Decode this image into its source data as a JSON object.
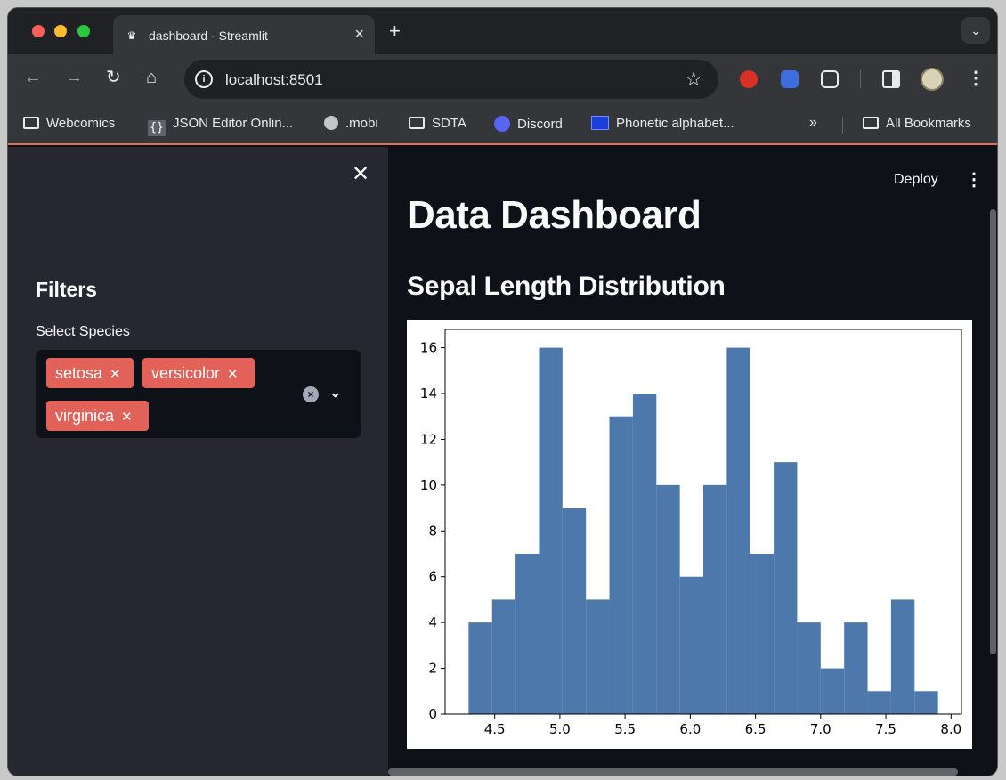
{
  "browser": {
    "tab_title": "dashboard · Streamlit",
    "tab_icon": "streamlit-crown-icon",
    "url": "localhost:8501",
    "bookmarks": [
      {
        "label": "Webcomics",
        "icon": "folder-icon"
      },
      {
        "label": "JSON Editor Onlin...",
        "icon": "braces-icon"
      },
      {
        "label": ".mobi",
        "icon": "globe-icon"
      },
      {
        "label": "SDTA",
        "icon": "folder-icon"
      },
      {
        "label": "Discord",
        "icon": "discord-icon"
      },
      {
        "label": "Phonetic alphabet...",
        "icon": "phonetic-icon"
      }
    ],
    "bookmarks_more": "»",
    "all_bookmarks": "All Bookmarks"
  },
  "sidebar": {
    "title": "Filters",
    "select_label": "Select Species",
    "chips": [
      "setosa",
      "versicolor",
      "virginica"
    ]
  },
  "main": {
    "deploy_label": "Deploy",
    "title": "Data Dashboard",
    "subtitle": "Sepal Length Distribution"
  },
  "colors": {
    "bar": "#4c78ab",
    "chip": "#e2625a",
    "sidebar_bg": "#262730",
    "main_bg": "#0e1117"
  },
  "chart_data": {
    "type": "bar",
    "title": "",
    "xlabel": "",
    "ylabel": "",
    "bin_edges": [
      4.3,
      4.48,
      4.66,
      4.84,
      5.02,
      5.2,
      5.38,
      5.56,
      5.74,
      5.92,
      6.1,
      6.28,
      6.46,
      6.64,
      6.82,
      7.0,
      7.18,
      7.36,
      7.54,
      7.72,
      7.9
    ],
    "values": [
      4,
      5,
      7,
      16,
      9,
      5,
      13,
      14,
      10,
      6,
      10,
      16,
      7,
      11,
      4,
      2,
      4,
      1,
      5,
      1
    ],
    "xlim": [
      4.12,
      8.08
    ],
    "ylim": [
      0,
      16.8
    ],
    "xticks": [
      4.5,
      5.0,
      5.5,
      6.0,
      6.5,
      7.0,
      7.5,
      8.0
    ],
    "xtick_labels": [
      "4.5",
      "5.0",
      "5.5",
      "6.0",
      "6.5",
      "7.0",
      "7.5",
      "8.0"
    ],
    "yticks": [
      0,
      2,
      4,
      6,
      8,
      10,
      12,
      14,
      16
    ],
    "ytick_labels": [
      "0",
      "2",
      "4",
      "6",
      "8",
      "10",
      "12",
      "14",
      "16"
    ],
    "grid": false,
    "legend": "none"
  }
}
